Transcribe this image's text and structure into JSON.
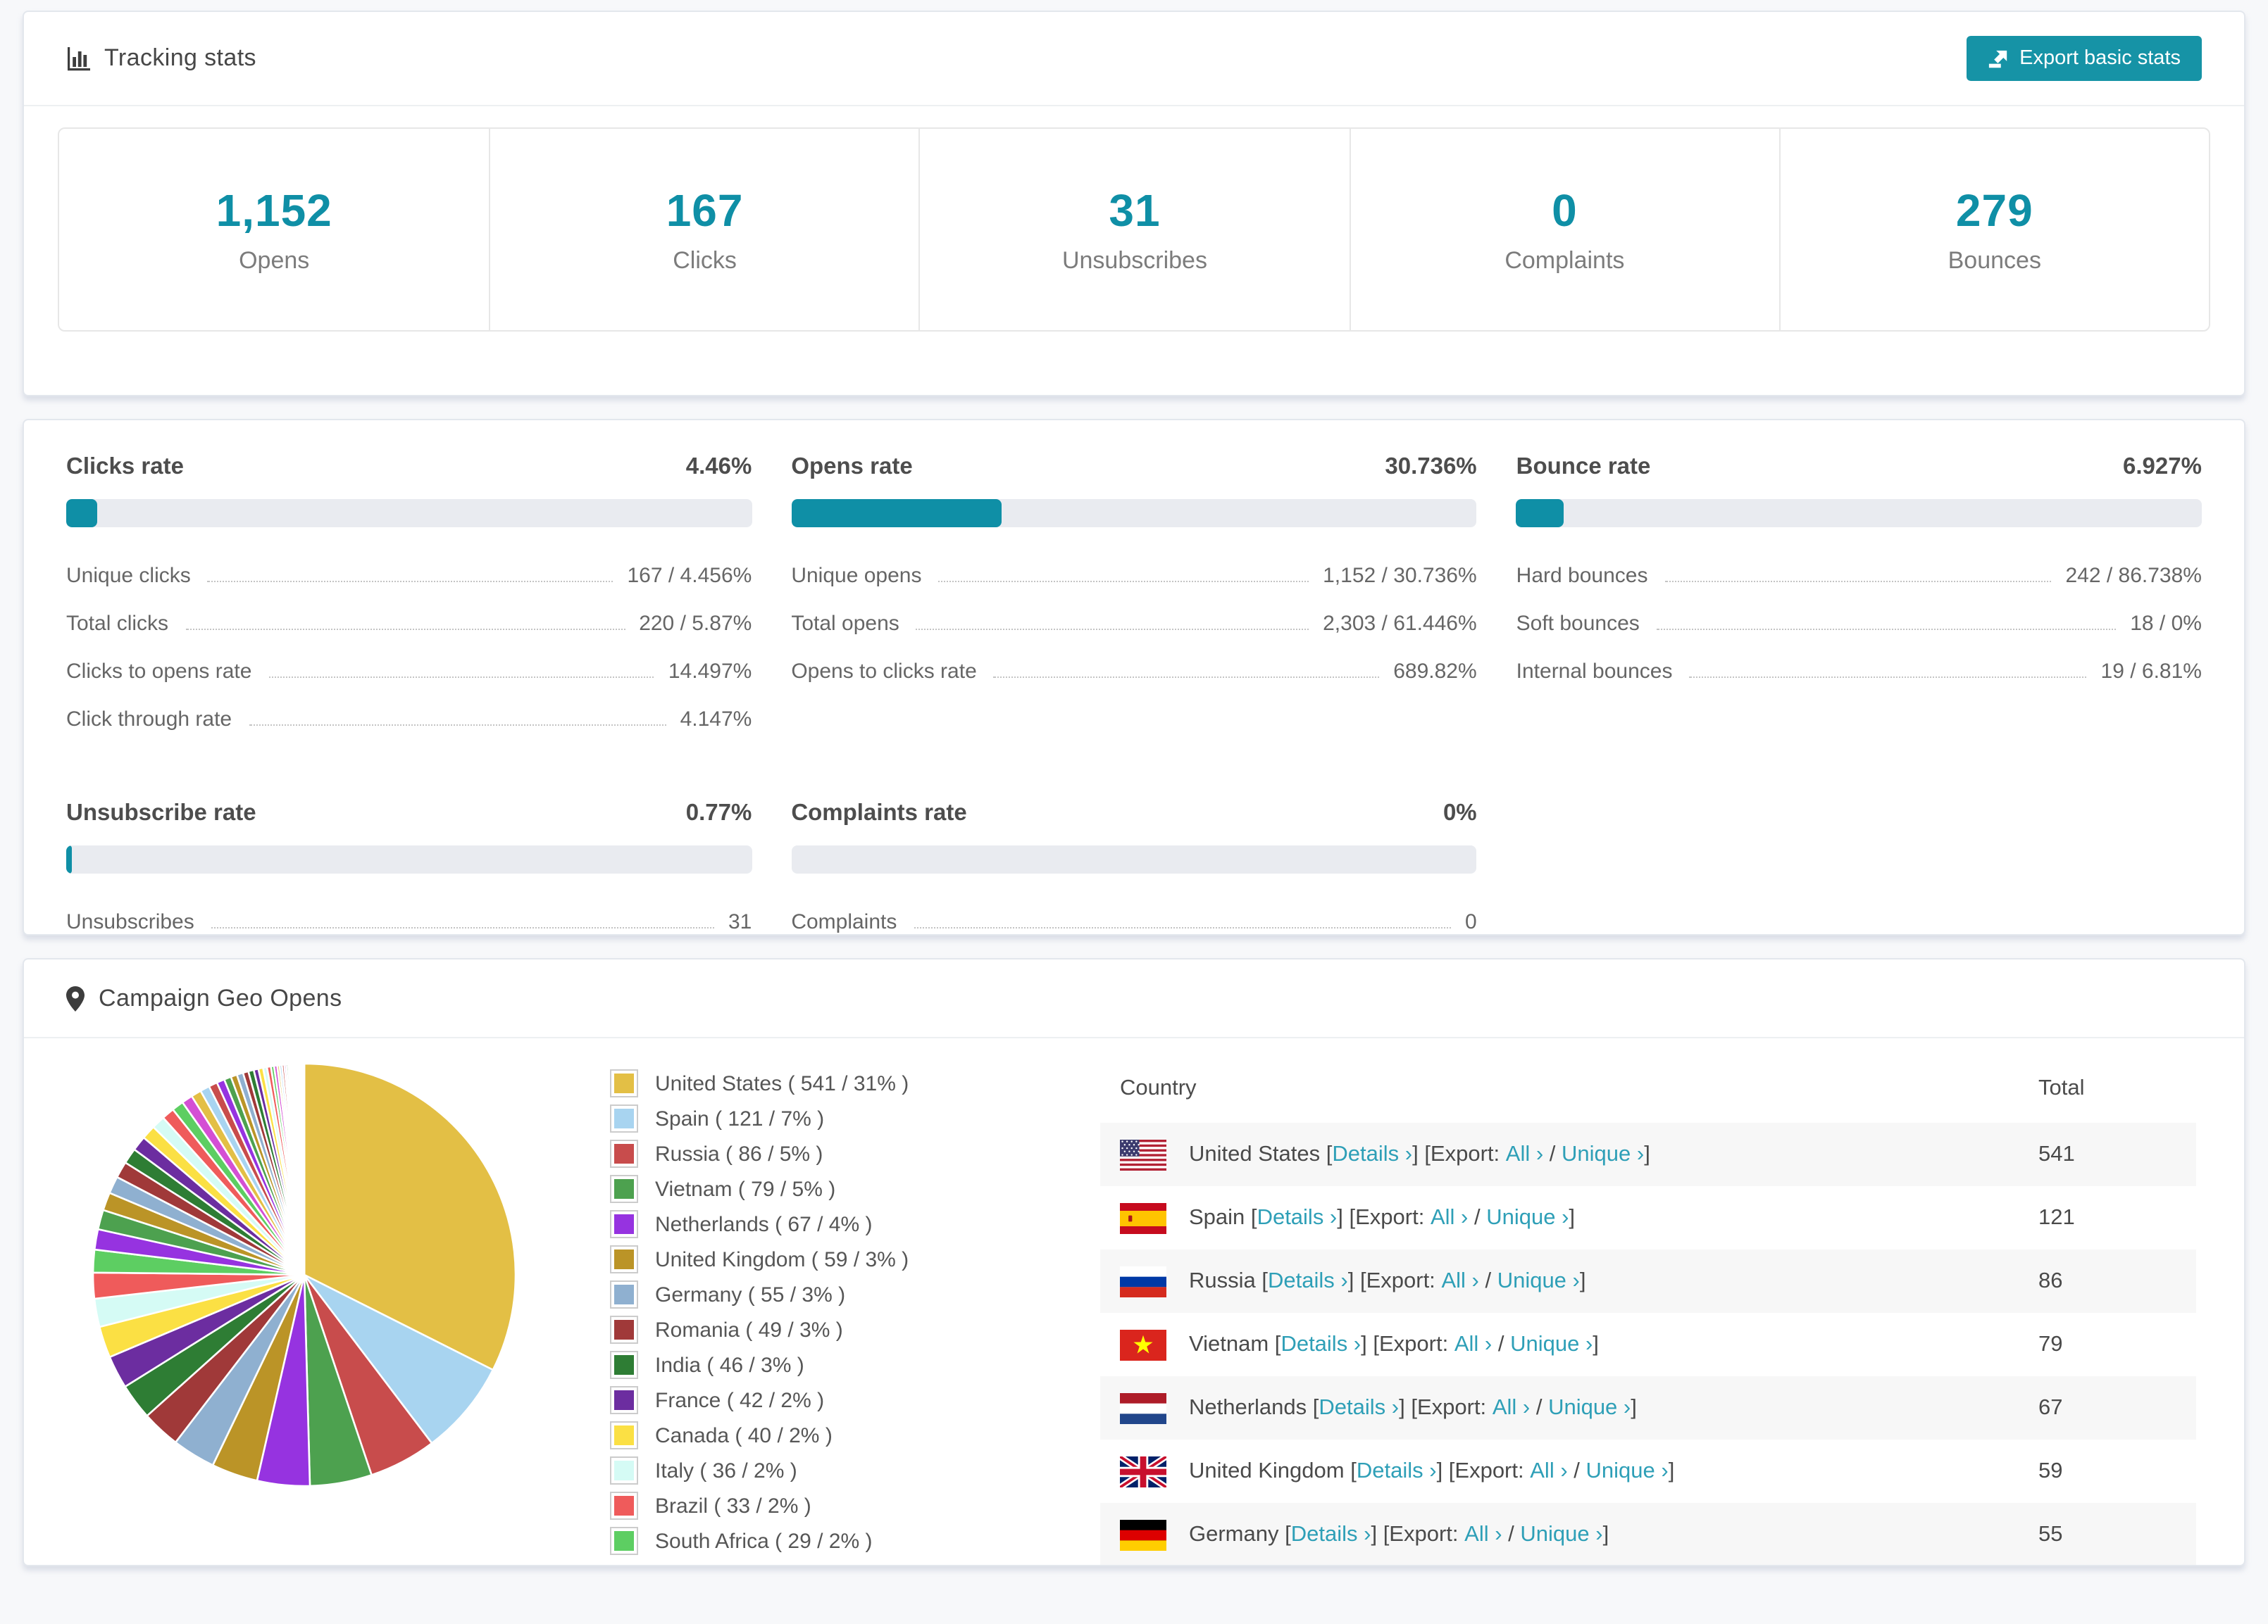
{
  "theme": {
    "accent": "#0f8fa6",
    "button_bg": "#1693a6",
    "link": "#2e9fb7",
    "bar_track": "#e9ebf0",
    "row_stripe": "#f7f7f7",
    "page_bg": "#f7f8fa"
  },
  "tracking": {
    "title": "Tracking stats",
    "export_button": "Export basic stats",
    "stats": [
      {
        "value": "1,152",
        "label": "Opens"
      },
      {
        "value": "167",
        "label": "Clicks"
      },
      {
        "value": "31",
        "label": "Unsubscribes"
      },
      {
        "value": "0",
        "label": "Complaints"
      },
      {
        "value": "279",
        "label": "Bounces"
      }
    ]
  },
  "rates": {
    "panels": [
      {
        "title": "Clicks rate",
        "value": "4.46%",
        "pct": 4.46,
        "rows": [
          {
            "label": "Unique clicks",
            "value": "167 / 4.456%"
          },
          {
            "label": "Total clicks",
            "value": "220 / 5.87%"
          },
          {
            "label": "Clicks to opens rate",
            "value": "14.497%"
          },
          {
            "label": "Click through rate",
            "value": "4.147%"
          }
        ]
      },
      {
        "title": "Opens rate",
        "value": "30.736%",
        "pct": 30.736,
        "rows": [
          {
            "label": "Unique opens",
            "value": "1,152 / 30.736%"
          },
          {
            "label": "Total opens",
            "value": "2,303 / 61.446%"
          },
          {
            "label": "Opens to clicks rate",
            "value": "689.82%"
          }
        ]
      },
      {
        "title": "Bounce rate",
        "value": "6.927%",
        "pct": 6.927,
        "rows": [
          {
            "label": "Hard bounces",
            "value": "242 / 86.738%"
          },
          {
            "label": "Soft bounces",
            "value": "18 / 0%"
          },
          {
            "label": "Internal bounces",
            "value": "19 / 6.81%"
          }
        ]
      },
      {
        "title": "Unsubscribe rate",
        "value": "0.77%",
        "pct": 0.77,
        "rows": [
          {
            "label": "Unsubscribes",
            "value": "31"
          }
        ]
      },
      {
        "title": "Complaints rate",
        "value": "0%",
        "pct": 0,
        "rows": [
          {
            "label": "Complaints",
            "value": "0"
          }
        ]
      }
    ]
  },
  "chart_data": {
    "type": "pie",
    "title": "Campaign Geo Opens",
    "legend_position": "right",
    "start_angle_deg": -90,
    "slices": [
      {
        "label": "United States",
        "value": 541,
        "pct": 31,
        "color": "#e3bf45"
      },
      {
        "label": "Spain",
        "value": 121,
        "pct": 7,
        "color": "#a8d4f0"
      },
      {
        "label": "Russia",
        "value": 86,
        "pct": 5,
        "color": "#c84c4c"
      },
      {
        "label": "Vietnam",
        "value": 79,
        "pct": 5,
        "color": "#4da14f"
      },
      {
        "label": "Netherlands",
        "value": 67,
        "pct": 4,
        "color": "#9633e0"
      },
      {
        "label": "United Kingdom",
        "value": 59,
        "pct": 3,
        "color": "#bb9427"
      },
      {
        "label": "Germany",
        "value": 55,
        "pct": 3,
        "color": "#8fb0d0"
      },
      {
        "label": "Romania",
        "value": 49,
        "pct": 3,
        "color": "#a03939"
      },
      {
        "label": "India",
        "value": 46,
        "pct": 3,
        "color": "#2e7d34"
      },
      {
        "label": "France",
        "value": 42,
        "pct": 2,
        "color": "#6c2da0"
      },
      {
        "label": "Canada",
        "value": 40,
        "pct": 2,
        "color": "#fbe044"
      },
      {
        "label": "Italy",
        "value": 36,
        "pct": 2,
        "color": "#d5fbf5"
      },
      {
        "label": "Brazil",
        "value": 33,
        "pct": 2,
        "color": "#ef5b5b"
      },
      {
        "label": "South Africa",
        "value": 29,
        "pct": 2,
        "color": "#5dce62"
      }
    ],
    "unlabeled_tail_values": [
      26,
      25,
      23,
      22,
      21,
      20,
      19,
      18,
      17,
      16,
      15,
      14,
      13,
      12,
      11,
      10,
      9,
      8,
      8,
      7,
      7,
      6,
      6,
      5,
      5,
      4,
      4,
      3,
      3,
      3,
      2.5,
      2.5,
      2,
      2,
      2,
      1.8,
      1.6,
      1.4,
      1.2,
      1,
      1,
      0.9,
      0.8,
      0.7,
      0.6,
      0.5,
      0.5,
      0.4,
      0.4,
      0.3,
      0.3,
      0.2,
      0.2,
      0.2,
      0.1,
      0.1
    ],
    "tail_palette": [
      "#9633e0",
      "#4da14f",
      "#bb9427",
      "#8fb0d0",
      "#a03939",
      "#2e7d34",
      "#6c2da0",
      "#fbe044",
      "#d5fbf5",
      "#ef5b5b",
      "#5dce62",
      "#d44fd4",
      "#e3bf45",
      "#a8d4f0",
      "#c84c4c"
    ]
  },
  "geo": {
    "title": "Campaign Geo Opens",
    "table": {
      "columns": [
        "Country",
        "Total"
      ],
      "link_labels": {
        "details": "Details",
        "export": "Export:",
        "all": "All",
        "unique": "Unique"
      },
      "rows": [
        {
          "country": "United States",
          "flag": "us",
          "total": "541"
        },
        {
          "country": "Spain",
          "flag": "es",
          "total": "121"
        },
        {
          "country": "Russia",
          "flag": "ru",
          "total": "86"
        },
        {
          "country": "Vietnam",
          "flag": "vn",
          "total": "79"
        },
        {
          "country": "Netherlands",
          "flag": "nl",
          "total": "67"
        },
        {
          "country": "United Kingdom",
          "flag": "gb",
          "total": "59"
        },
        {
          "country": "Germany",
          "flag": "de",
          "total": "55"
        }
      ]
    }
  }
}
